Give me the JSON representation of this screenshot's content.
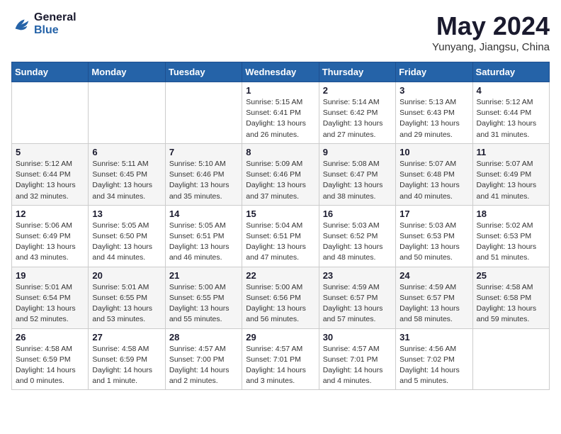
{
  "header": {
    "logo_line1": "General",
    "logo_line2": "Blue",
    "month_title": "May 2024",
    "location": "Yunyang, Jiangsu, China"
  },
  "weekdays": [
    "Sunday",
    "Monday",
    "Tuesday",
    "Wednesday",
    "Thursday",
    "Friday",
    "Saturday"
  ],
  "weeks": [
    [
      {
        "day": "",
        "info": ""
      },
      {
        "day": "",
        "info": ""
      },
      {
        "day": "",
        "info": ""
      },
      {
        "day": "1",
        "info": "Sunrise: 5:15 AM\nSunset: 6:41 PM\nDaylight: 13 hours\nand 26 minutes."
      },
      {
        "day": "2",
        "info": "Sunrise: 5:14 AM\nSunset: 6:42 PM\nDaylight: 13 hours\nand 27 minutes."
      },
      {
        "day": "3",
        "info": "Sunrise: 5:13 AM\nSunset: 6:43 PM\nDaylight: 13 hours\nand 29 minutes."
      },
      {
        "day": "4",
        "info": "Sunrise: 5:12 AM\nSunset: 6:44 PM\nDaylight: 13 hours\nand 31 minutes."
      }
    ],
    [
      {
        "day": "5",
        "info": "Sunrise: 5:12 AM\nSunset: 6:44 PM\nDaylight: 13 hours\nand 32 minutes."
      },
      {
        "day": "6",
        "info": "Sunrise: 5:11 AM\nSunset: 6:45 PM\nDaylight: 13 hours\nand 34 minutes."
      },
      {
        "day": "7",
        "info": "Sunrise: 5:10 AM\nSunset: 6:46 PM\nDaylight: 13 hours\nand 35 minutes."
      },
      {
        "day": "8",
        "info": "Sunrise: 5:09 AM\nSunset: 6:46 PM\nDaylight: 13 hours\nand 37 minutes."
      },
      {
        "day": "9",
        "info": "Sunrise: 5:08 AM\nSunset: 6:47 PM\nDaylight: 13 hours\nand 38 minutes."
      },
      {
        "day": "10",
        "info": "Sunrise: 5:07 AM\nSunset: 6:48 PM\nDaylight: 13 hours\nand 40 minutes."
      },
      {
        "day": "11",
        "info": "Sunrise: 5:07 AM\nSunset: 6:49 PM\nDaylight: 13 hours\nand 41 minutes."
      }
    ],
    [
      {
        "day": "12",
        "info": "Sunrise: 5:06 AM\nSunset: 6:49 PM\nDaylight: 13 hours\nand 43 minutes."
      },
      {
        "day": "13",
        "info": "Sunrise: 5:05 AM\nSunset: 6:50 PM\nDaylight: 13 hours\nand 44 minutes."
      },
      {
        "day": "14",
        "info": "Sunrise: 5:05 AM\nSunset: 6:51 PM\nDaylight: 13 hours\nand 46 minutes."
      },
      {
        "day": "15",
        "info": "Sunrise: 5:04 AM\nSunset: 6:51 PM\nDaylight: 13 hours\nand 47 minutes."
      },
      {
        "day": "16",
        "info": "Sunrise: 5:03 AM\nSunset: 6:52 PM\nDaylight: 13 hours\nand 48 minutes."
      },
      {
        "day": "17",
        "info": "Sunrise: 5:03 AM\nSunset: 6:53 PM\nDaylight: 13 hours\nand 50 minutes."
      },
      {
        "day": "18",
        "info": "Sunrise: 5:02 AM\nSunset: 6:53 PM\nDaylight: 13 hours\nand 51 minutes."
      }
    ],
    [
      {
        "day": "19",
        "info": "Sunrise: 5:01 AM\nSunset: 6:54 PM\nDaylight: 13 hours\nand 52 minutes."
      },
      {
        "day": "20",
        "info": "Sunrise: 5:01 AM\nSunset: 6:55 PM\nDaylight: 13 hours\nand 53 minutes."
      },
      {
        "day": "21",
        "info": "Sunrise: 5:00 AM\nSunset: 6:55 PM\nDaylight: 13 hours\nand 55 minutes."
      },
      {
        "day": "22",
        "info": "Sunrise: 5:00 AM\nSunset: 6:56 PM\nDaylight: 13 hours\nand 56 minutes."
      },
      {
        "day": "23",
        "info": "Sunrise: 4:59 AM\nSunset: 6:57 PM\nDaylight: 13 hours\nand 57 minutes."
      },
      {
        "day": "24",
        "info": "Sunrise: 4:59 AM\nSunset: 6:57 PM\nDaylight: 13 hours\nand 58 minutes."
      },
      {
        "day": "25",
        "info": "Sunrise: 4:58 AM\nSunset: 6:58 PM\nDaylight: 13 hours\nand 59 minutes."
      }
    ],
    [
      {
        "day": "26",
        "info": "Sunrise: 4:58 AM\nSunset: 6:59 PM\nDaylight: 14 hours\nand 0 minutes."
      },
      {
        "day": "27",
        "info": "Sunrise: 4:58 AM\nSunset: 6:59 PM\nDaylight: 14 hours\nand 1 minute."
      },
      {
        "day": "28",
        "info": "Sunrise: 4:57 AM\nSunset: 7:00 PM\nDaylight: 14 hours\nand 2 minutes."
      },
      {
        "day": "29",
        "info": "Sunrise: 4:57 AM\nSunset: 7:01 PM\nDaylight: 14 hours\nand 3 minutes."
      },
      {
        "day": "30",
        "info": "Sunrise: 4:57 AM\nSunset: 7:01 PM\nDaylight: 14 hours\nand 4 minutes."
      },
      {
        "day": "31",
        "info": "Sunrise: 4:56 AM\nSunset: 7:02 PM\nDaylight: 14 hours\nand 5 minutes."
      },
      {
        "day": "",
        "info": ""
      }
    ]
  ]
}
